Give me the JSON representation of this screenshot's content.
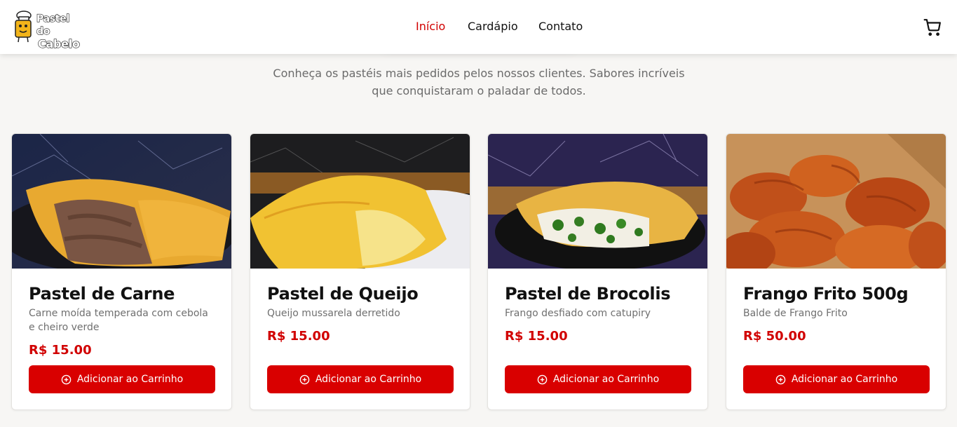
{
  "header": {
    "logo": {
      "line1": "Pastel do",
      "line2": "Cabelo"
    },
    "nav": [
      {
        "label": "Início",
        "active": true
      },
      {
        "label": "Cardápio"
      },
      {
        "label": "Contato"
      }
    ],
    "cart_icon": "shopping-cart-icon"
  },
  "hero": {
    "subtitle": "Conheça os pastéis mais pedidos pelos nossos clientes. Sabores incríveis que conquistaram o paladar de todos."
  },
  "products": [
    {
      "name": "Pastel de Carne",
      "description": "Carne moída temperada com cebola e cheiro verde",
      "price": "R$ 15.00",
      "button": "Adicionar ao Carrinho"
    },
    {
      "name": "Pastel de Queijo",
      "description": "Queijo mussarela derretido",
      "price": "R$ 15.00",
      "button": "Adicionar ao Carrinho"
    },
    {
      "name": "Pastel de Brocolis",
      "description": "Frango desfiado com catupiry",
      "price": "R$ 15.00",
      "button": "Adicionar ao Carrinho"
    },
    {
      "name": "Frango Frito 500g",
      "description": "Balde de Frango Frito",
      "price": "R$ 50.00",
      "button": "Adicionar ao Carrinho"
    }
  ],
  "colors": {
    "accent": "#d90000",
    "active_nav": "#d10000",
    "price": "#d10000"
  }
}
